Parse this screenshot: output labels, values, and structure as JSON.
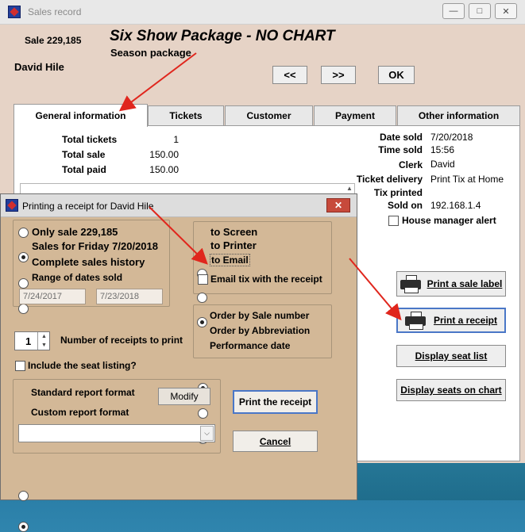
{
  "back_window": {
    "title": "Sales record",
    "sale_label": "Sale 229,185",
    "package_title": "Six Show Package - NO CHART",
    "package_subtitle": "Season package",
    "customer_name": "David Hile",
    "nav": {
      "prev": "<<",
      "next": ">>",
      "ok": "OK"
    },
    "tabs": [
      "General information",
      "Tickets",
      "Customer",
      "Payment",
      "Other information"
    ],
    "totals": [
      {
        "label": "Total tickets",
        "value": "1"
      },
      {
        "label": "Total sale",
        "value": "150.00"
      },
      {
        "label": "Total paid",
        "value": "150.00"
      }
    ],
    "details": [
      {
        "label": "Date sold",
        "value": "7/20/2018"
      },
      {
        "label": "Time sold",
        "value": "15:56"
      },
      {
        "label": "Clerk",
        "value": "David"
      },
      {
        "label": "Ticket delivery",
        "value": "Print Tix at Home"
      },
      {
        "label": "Tix printed",
        "value": ""
      },
      {
        "label": "Sold on",
        "value": "192.168.1.4"
      }
    ],
    "house_manager_alert": "House manager alert",
    "buttons": {
      "print_sale_label": "Print a sale label",
      "print_receipt": "Print a receipt",
      "display_seat_list": "Display seat list",
      "display_seats_chart": "Display seats on chart"
    }
  },
  "dialog": {
    "title": "Printing a receipt for David Hile",
    "scope_options": [
      {
        "label": "Only sale 229,185",
        "selected": false
      },
      {
        "label": "Sales for Friday 7/20/2018",
        "selected": true
      },
      {
        "label": "Complete sales history",
        "selected": false
      },
      {
        "label": "Range of dates sold",
        "selected": false
      }
    ],
    "date_from": "7/24/2017",
    "date_to": "7/23/2018",
    "destination_options": [
      {
        "label": "to Screen",
        "selected": false
      },
      {
        "label": "to Printer",
        "selected": false
      },
      {
        "label": "to Email",
        "selected": true
      }
    ],
    "email_tix": "Email tix with the receipt",
    "order_options": [
      {
        "label": "Order by Sale number",
        "selected": true
      },
      {
        "label": "Order by Abbreviation",
        "selected": false
      },
      {
        "label": "Performance date",
        "selected": false
      }
    ],
    "num_receipts_value": "1",
    "num_receipts_label": "Number of receipts to print",
    "include_seat_listing": "Include the seat listing?",
    "format_options": [
      {
        "label": "Standard report format",
        "selected": false
      },
      {
        "label": "Custom report format",
        "selected": true
      }
    ],
    "modify": "Modify",
    "print_receipt": "Print the receipt",
    "cancel": "Cancel",
    "custom_format_value": ""
  },
  "colors": {
    "annotation_arrow": "#e0261d",
    "dialog_bg": "#d3b897",
    "window_bg": "#e6d3c6"
  }
}
